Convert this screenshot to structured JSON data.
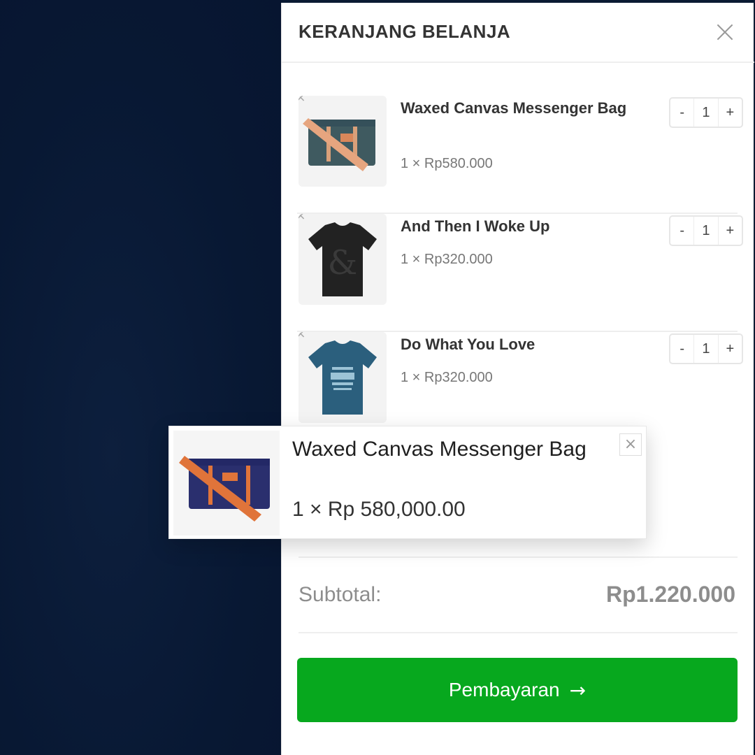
{
  "cart": {
    "title": "KERANJANG BELANJA",
    "items": [
      {
        "name": "Waxed Canvas Messenger Bag",
        "price": "1 × Rp580.000",
        "qty": "1",
        "remove": "×",
        "minus": "-",
        "plus": "+"
      },
      {
        "name": "And Then I Woke Up",
        "price": "1 × Rp320.000",
        "qty": "1",
        "remove": "×",
        "minus": "-",
        "plus": "+"
      },
      {
        "name": "Do What You Love",
        "price": "1 × Rp320.000",
        "qty": "1",
        "remove": "×",
        "minus": "-",
        "plus": "+"
      }
    ],
    "subtotal_label": "Subtotal:",
    "subtotal_value": "Rp1.220.000",
    "checkout_label": "Pembayaran",
    "checkout_arrow": "→"
  },
  "notification": {
    "name": "Waxed Canvas Messenger Bag",
    "price": "1 ×  Rp  580,000.00",
    "close": "×"
  },
  "colors": {
    "backdrop": "#0a1a33",
    "checkout": "#07a81e",
    "bag_green": "#3f5a60",
    "bag_navy": "#2a2f6e",
    "strap": "#e0743a"
  },
  "icons": {
    "close": "close-icon",
    "remove": "remove-item-icon",
    "arrow": "arrow-right-icon"
  }
}
